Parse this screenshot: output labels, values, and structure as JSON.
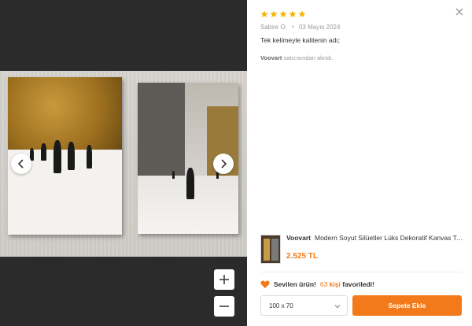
{
  "review": {
    "rating": 5,
    "author": "Sabire O.",
    "date": "03 Mayıs 2024",
    "text": "Tek kelimeyle kalitenin adı;",
    "seller_name": "Voovart",
    "seller_suffix": "satıcısından alındı."
  },
  "product": {
    "brand": "Voovart",
    "name": "Modern Soyut Silüetler Lüks Dekoratif Kanvas Tablo",
    "price": "2.525 TL"
  },
  "favorites": {
    "label": "Sevilen ürün!",
    "count": "63",
    "count_suffix": "kişi",
    "tail": "favoriledi!"
  },
  "size_select": {
    "value": "100 x 70"
  },
  "cart_button": {
    "label": "Sepete Ekle"
  },
  "colors": {
    "accent": "#f27a1a",
    "star": "#f7b500",
    "viewer_bg": "#2b2b2b"
  },
  "icons": {
    "close": "close-icon",
    "prev": "chevron-left-icon",
    "next": "chevron-right-icon",
    "zoom_in": "plus-icon",
    "zoom_out": "minus-icon",
    "heart": "heart-icon",
    "dropdown": "chevron-down-icon"
  }
}
